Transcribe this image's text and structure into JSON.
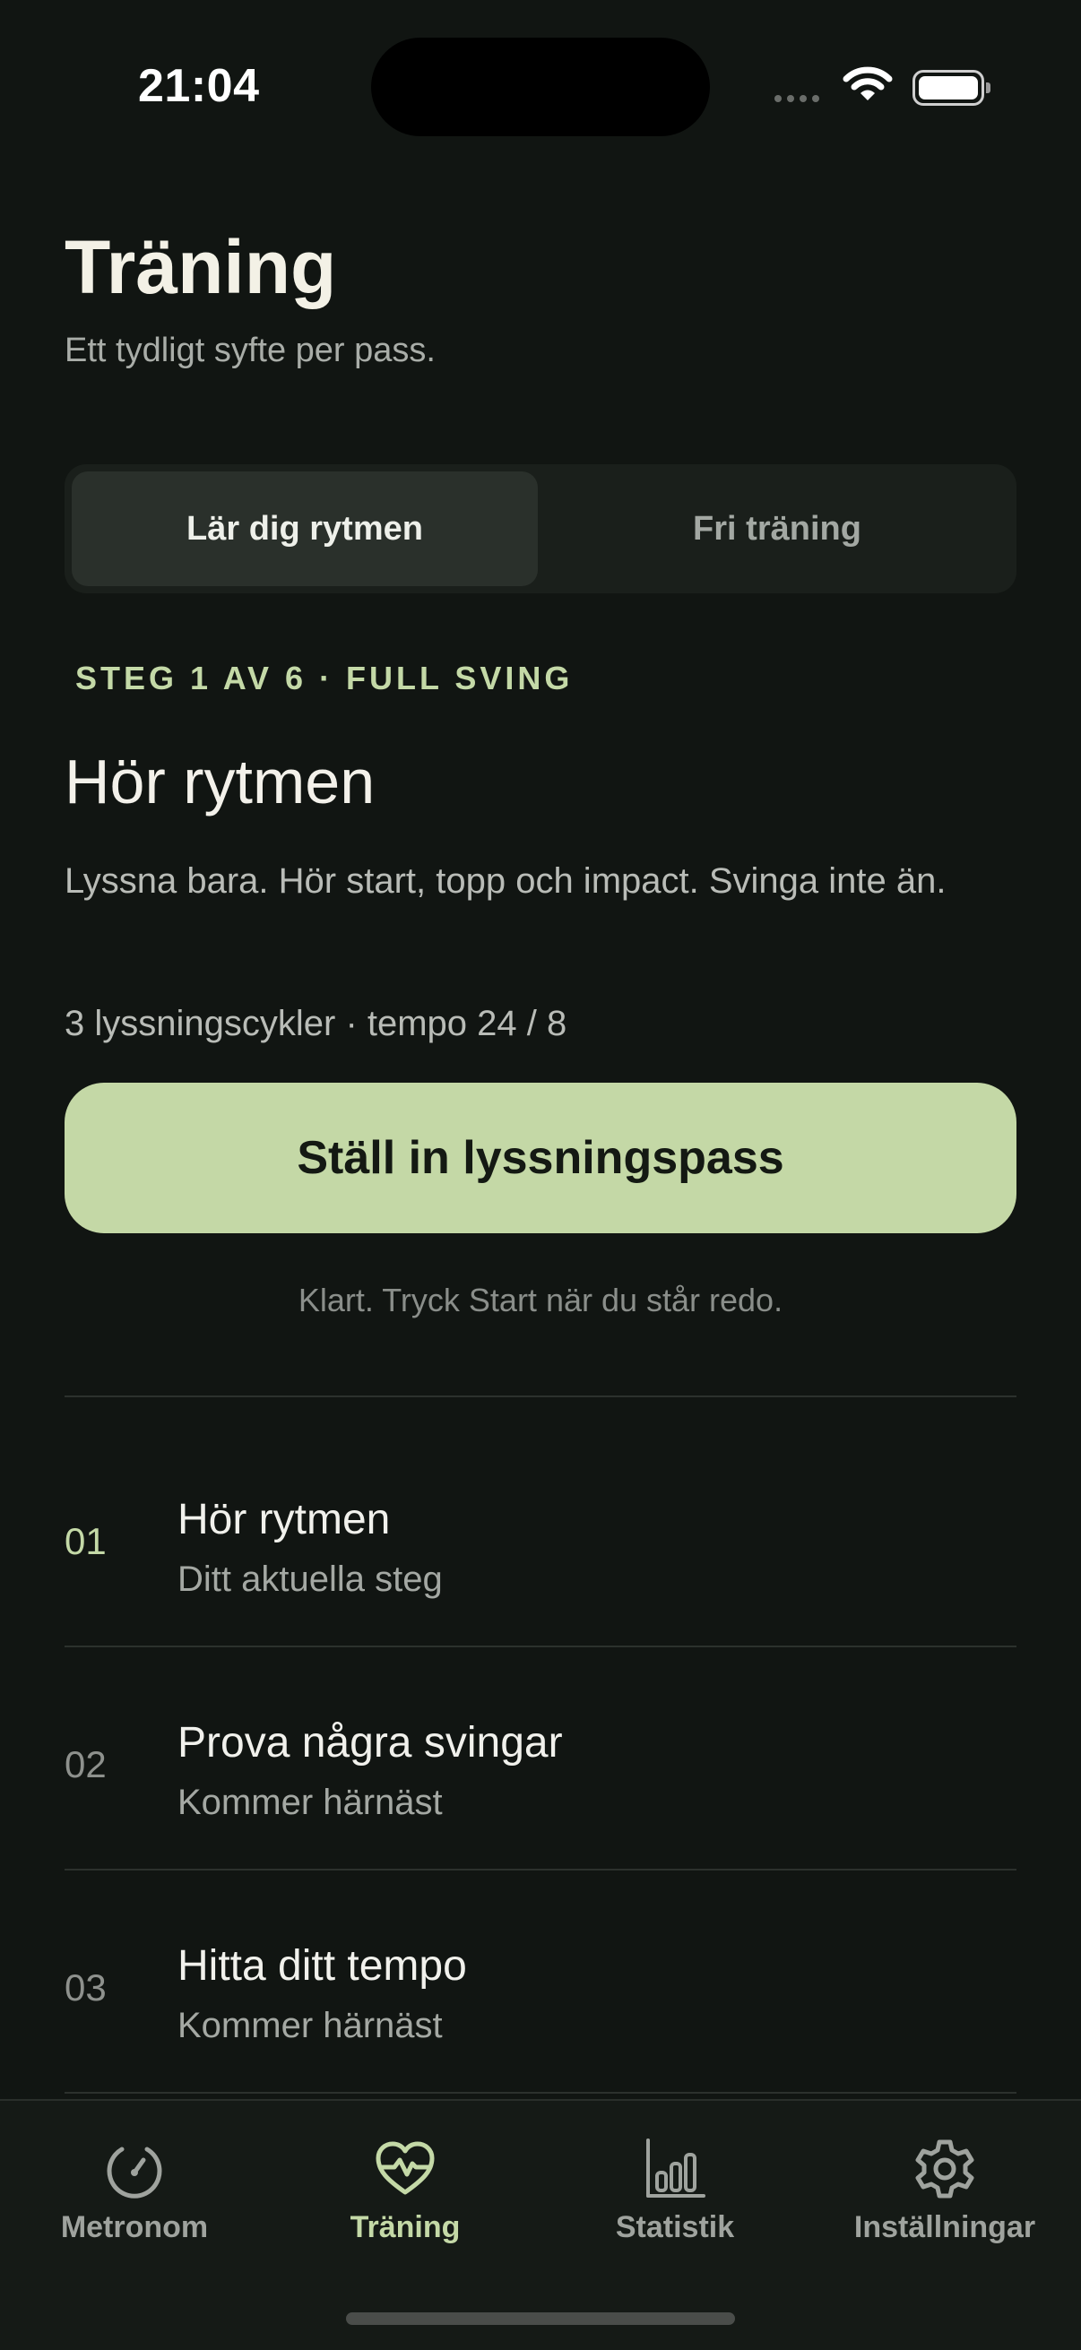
{
  "status_bar": {
    "time": "21:04"
  },
  "header": {
    "title": "Träning",
    "subtitle": "Ett tydligt syfte per pass."
  },
  "segments": {
    "learn": "Lär dig rytmen",
    "free": "Fri träning"
  },
  "step": {
    "overline": "STEG 1 AV 6 · FULL SVING",
    "title": "Hör rytmen",
    "description": "Lyssna bara. Hör start, topp och impact. Svinga inte än.",
    "meta": "3 lyssningscykler · tempo 24 / 8",
    "button_label": "Ställ in lyssningspass",
    "hint": "Klart. Tryck Start när du står redo."
  },
  "steps": [
    {
      "number": "01",
      "title": "Hör rytmen",
      "subtitle": "Ditt aktuella steg",
      "active": true
    },
    {
      "number": "02",
      "title": "Prova några svingar",
      "subtitle": "Kommer härnäst",
      "active": false
    },
    {
      "number": "03",
      "title": "Hitta ditt tempo",
      "subtitle": "Kommer härnäst",
      "active": false
    }
  ],
  "tabs": [
    {
      "label": "Metronom",
      "icon": "metronome-dial-icon"
    },
    {
      "label": "Träning",
      "icon": "heart-pulse-icon",
      "active": true
    },
    {
      "label": "Statistik",
      "icon": "bar-chart-icon"
    },
    {
      "label": "Inställningar",
      "icon": "gear-icon"
    }
  ],
  "colors": {
    "background": "#111512",
    "accent": "#c4d9a7",
    "button": "#c4d8a6"
  }
}
